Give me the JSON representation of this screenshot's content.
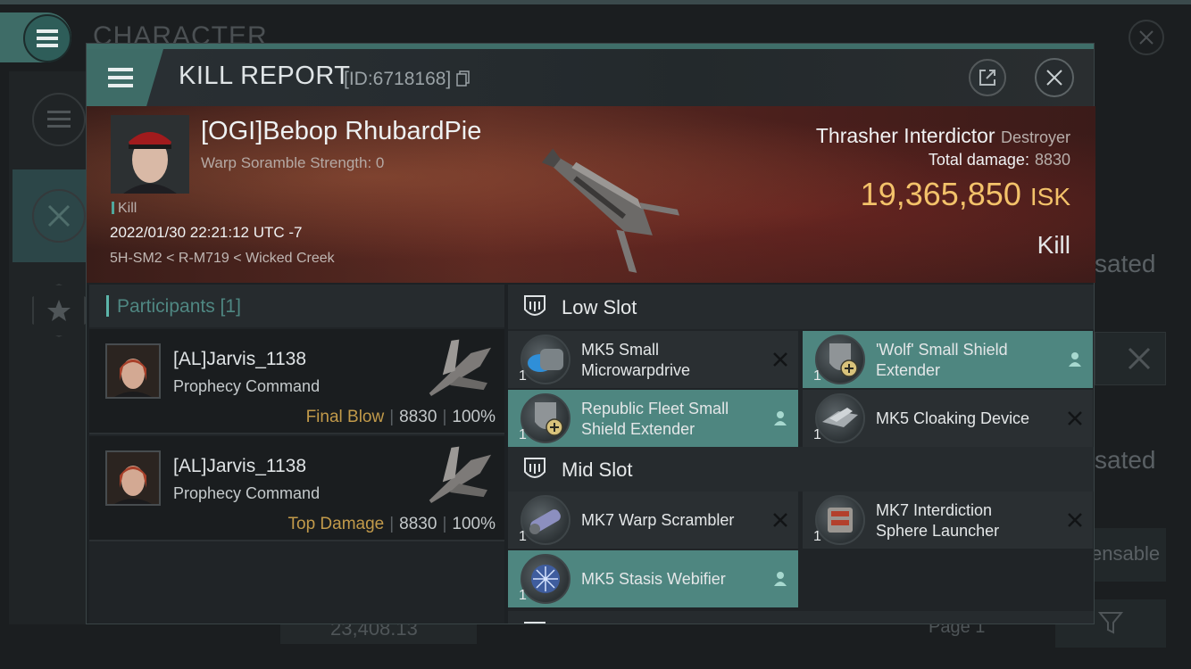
{
  "background": {
    "title": "CHARACTER",
    "right_texts": [
      "sated",
      "sated",
      "ensable"
    ],
    "bottom_value": "23,408.13",
    "page_label": "Page 1"
  },
  "window": {
    "title": "KILL REPORT",
    "id_label": "[ID:6718168]",
    "colors": {
      "accent": "#3e6c67",
      "isk": "#f3c26a",
      "final_blow": "#c29a4a"
    }
  },
  "victim": {
    "name": "[OGI]Bebop RhubardPie",
    "warp_scramble": "Warp Soramble Strength: 0",
    "kill_tag": "Kill",
    "datetime": "2022/01/30 22:21:12 UTC -7",
    "location": "5H-SM2 < R-M719 < Wicked Creek",
    "ship_name": "Thrasher Interdictor",
    "ship_class": "Destroyer",
    "total_damage_label": "Total damage:",
    "total_damage": "8830",
    "isk_value": "19,365,850",
    "isk_unit": "ISK",
    "result": "Kill"
  },
  "participants": {
    "header": "Participants [1]",
    "rows": [
      {
        "name": "[AL]Jarvis_1138",
        "ship": "Prophecy Command",
        "role": "Final Blow",
        "damage": "8830",
        "percent": "100%"
      },
      {
        "name": "[AL]Jarvis_1138",
        "ship": "Prophecy Command",
        "role": "Top Damage",
        "damage": "8830",
        "percent": "100%"
      }
    ]
  },
  "slots": {
    "low_label": "Low Slot",
    "mid_label": "Mid Slot",
    "low": [
      {
        "name_line1": "MK5 Small",
        "name_line2": "Microwarpdrive",
        "qty": "1",
        "state": "destroyed"
      },
      {
        "name_line1": "'Wolf' Small Shield",
        "name_line2": "Extender",
        "qty": "1",
        "state": "dropped"
      },
      {
        "name_line1": "Republic Fleet Small",
        "name_line2": "Shield Extender",
        "qty": "1",
        "state": "dropped"
      },
      {
        "name_line1": "MK5 Cloaking Device",
        "name_line2": "",
        "qty": "1",
        "state": "destroyed"
      }
    ],
    "mid": [
      {
        "name_line1": "MK7 Warp Scrambler",
        "name_line2": "",
        "qty": "1",
        "state": "destroyed"
      },
      {
        "name_line1": "MK7 Interdiction",
        "name_line2": "Sphere Launcher",
        "qty": "1",
        "state": "destroyed"
      },
      {
        "name_line1": "MK5 Stasis Webifier",
        "name_line2": "",
        "qty": "1",
        "state": "dropped"
      }
    ]
  }
}
